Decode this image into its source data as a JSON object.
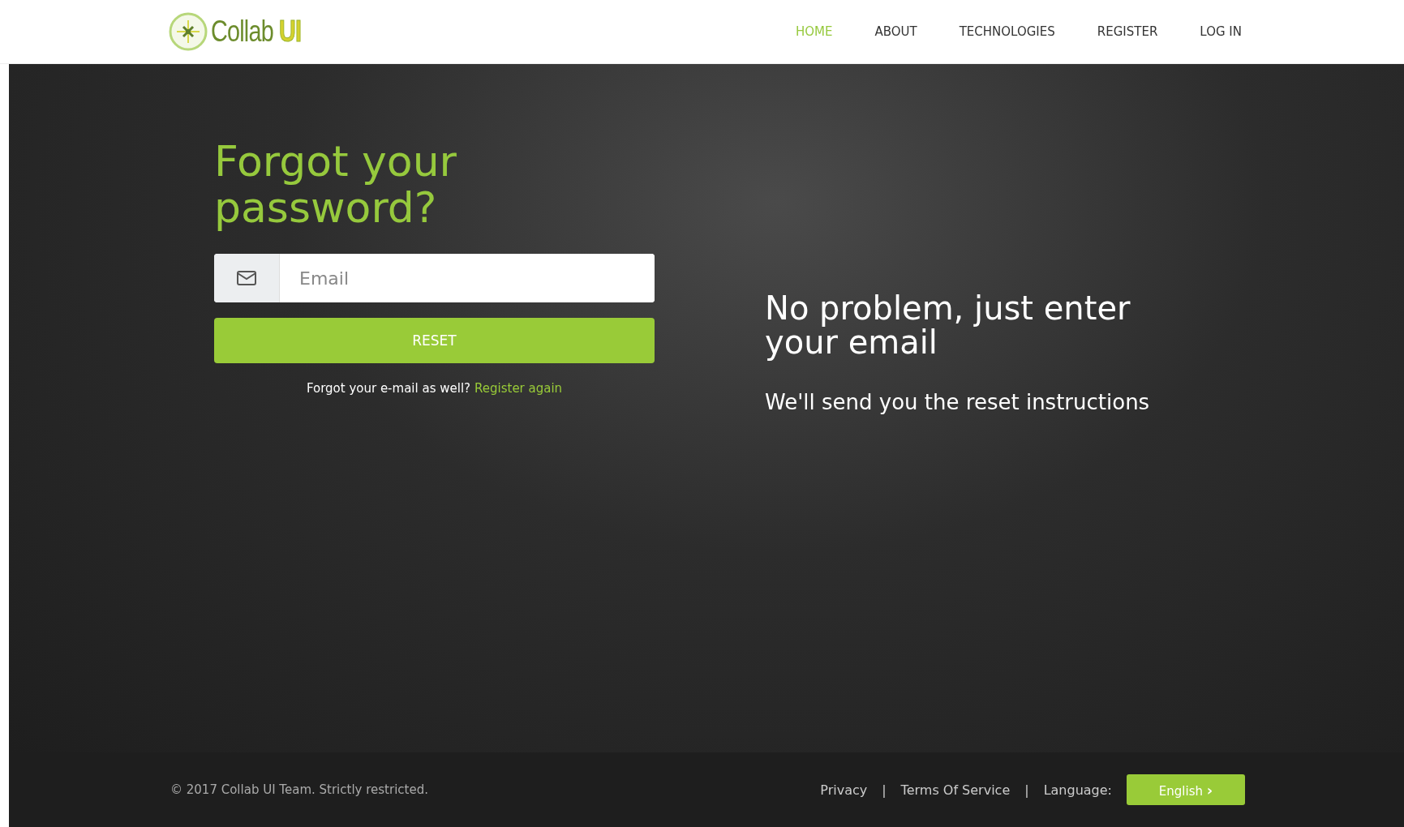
{
  "logo": {
    "name": "Collab",
    "accent": "UI"
  },
  "nav": [
    {
      "label": "HOME",
      "selected": true
    },
    {
      "label": "ABOUT",
      "selected": false
    },
    {
      "label": "TECHNOLOGIES",
      "selected": false
    },
    {
      "label": "REGISTER",
      "selected": false
    },
    {
      "label": "LOG IN",
      "selected": false
    }
  ],
  "form": {
    "title": "Forgot your password?",
    "email": {
      "placeholder": "Email"
    },
    "button": "RESET",
    "hint": "Forgot your e-mail as well?",
    "link": "Register again"
  },
  "aside": {
    "heading": "No problem, just enter your email",
    "text": "We'll send you the reset instructions"
  },
  "footer": {
    "copyright": "© 2017 Collab UI Team. Strictly restricted.",
    "links": [
      "Privacy",
      "Terms Of Service"
    ],
    "separator": "|",
    "language_label": "Language:",
    "language": "English",
    "language_icon": "›"
  }
}
